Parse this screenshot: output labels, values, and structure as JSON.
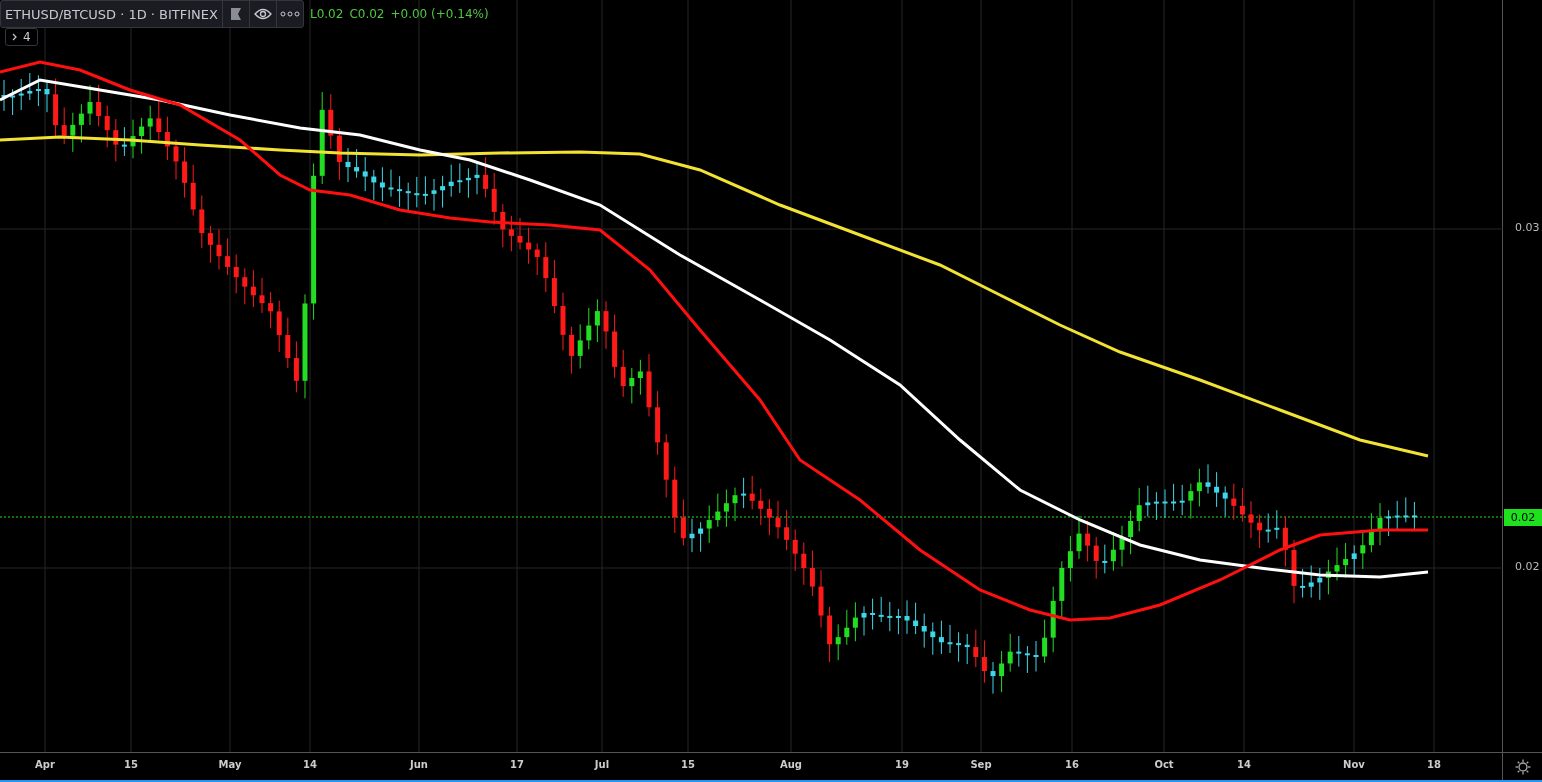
{
  "header": {
    "title": "ETHUSD/BTCUSD · 1D · BITFINEX",
    "legend": [
      {
        "text": "L0.02"
      },
      {
        "text": "C0.02"
      },
      {
        "text": "+0.00 (+0.14%)"
      }
    ]
  },
  "indicators_toggle": {
    "count": "4"
  },
  "price_axis": {
    "labels": [
      "0.03",
      "0.02"
    ],
    "last_price": "0.02"
  },
  "time_axis": {
    "labels": [
      "Apr",
      "15",
      "May",
      "14",
      "Jun",
      "17",
      "Jul",
      "15",
      "Aug",
      "19",
      "Sep",
      "16",
      "Oct",
      "14",
      "Nov",
      "18"
    ]
  }
}
